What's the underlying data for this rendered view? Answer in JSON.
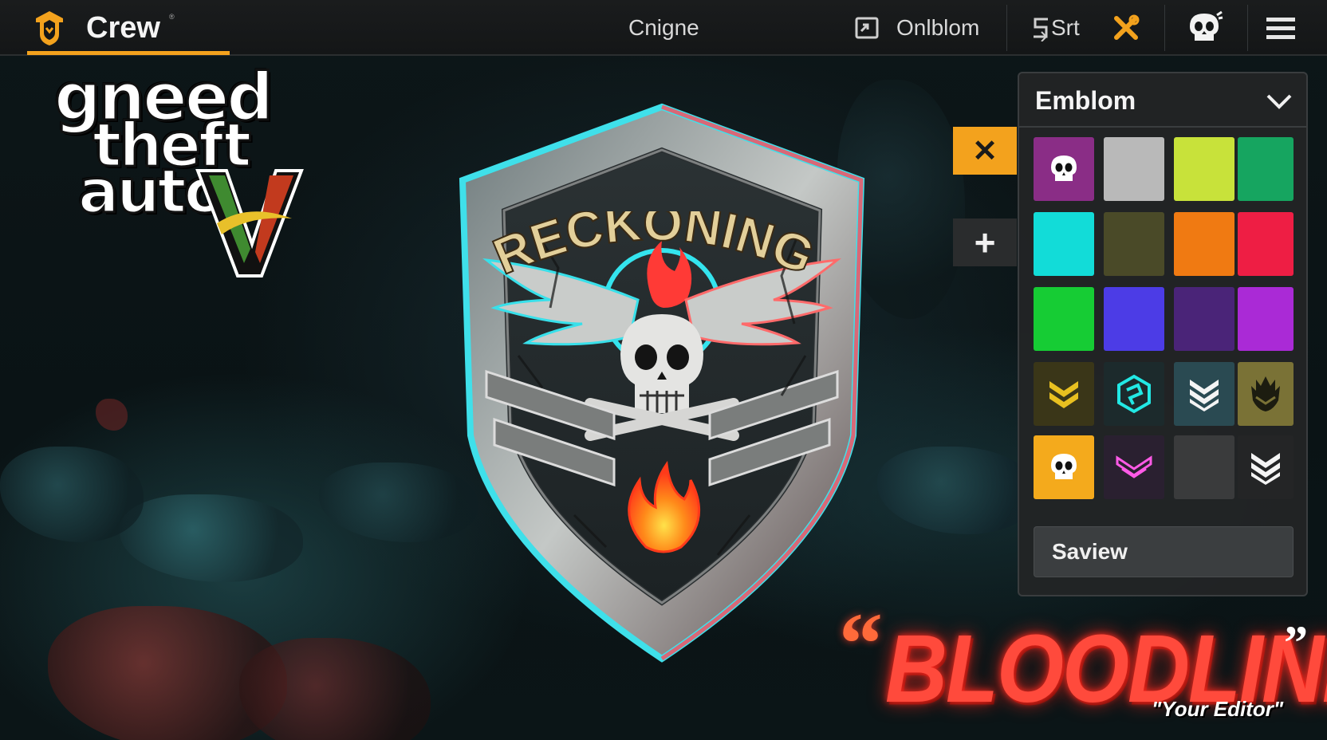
{
  "app": {
    "brand_name": "Crew",
    "brand_tm": "®",
    "accent": "#f3a21d"
  },
  "nav": {
    "center_label": "Cnigne",
    "emblem_label": "Onlblom",
    "sort_label": "Srt",
    "icons": [
      "refresh-icon",
      "sort-icon",
      "tools-icon",
      "skull-icon",
      "menu-icon"
    ]
  },
  "game_logo": {
    "line1": "gneed",
    "line2": "theft",
    "line3": "auto"
  },
  "emblem": {
    "title": "RECKONING"
  },
  "panel": {
    "title": "Emblom",
    "close_label": "✕",
    "add_label": "+",
    "save_label": "Saview",
    "swatches": [
      {
        "color": "#8a2d86",
        "icon": "skull-icon"
      },
      {
        "color": "#b9b9b9",
        "icon": ""
      },
      {
        "color": "#c8e23a",
        "icon": ""
      },
      {
        "color": "#16a560",
        "icon": ""
      },
      {
        "color": "#12dcd8",
        "icon": ""
      },
      {
        "color": "#4a4a28",
        "icon": ""
      },
      {
        "color": "#f07a12",
        "icon": ""
      },
      {
        "color": "#ee1e44",
        "icon": ""
      },
      {
        "color": "#16cc34",
        "icon": ""
      },
      {
        "color": "#4c3ce6",
        "icon": ""
      },
      {
        "color": "#4a2478",
        "icon": ""
      },
      {
        "color": "#aa2ad6",
        "icon": ""
      },
      {
        "color": "#3a3618",
        "icon": "chevrons-gold-icon"
      },
      {
        "color": "#1c2a2c",
        "icon": "hex-cyan-icon"
      },
      {
        "color": "#2a4a52",
        "icon": "chevrons-white-icon"
      },
      {
        "color": "#7a7236",
        "icon": "crest-icon"
      },
      {
        "color": "#f4aa1c",
        "icon": "skull-icon"
      },
      {
        "color": "#2a2030",
        "icon": "chevron-pink-icon"
      },
      {
        "color": "#3a3b3c",
        "icon": ""
      },
      {
        "color": "#242526",
        "icon": "chevrons-white-icon"
      }
    ]
  },
  "tagline": {
    "open_quote": "“",
    "main": "BLOODLINE",
    "close_quote": "”",
    "sub": "\"Your Editor\""
  }
}
